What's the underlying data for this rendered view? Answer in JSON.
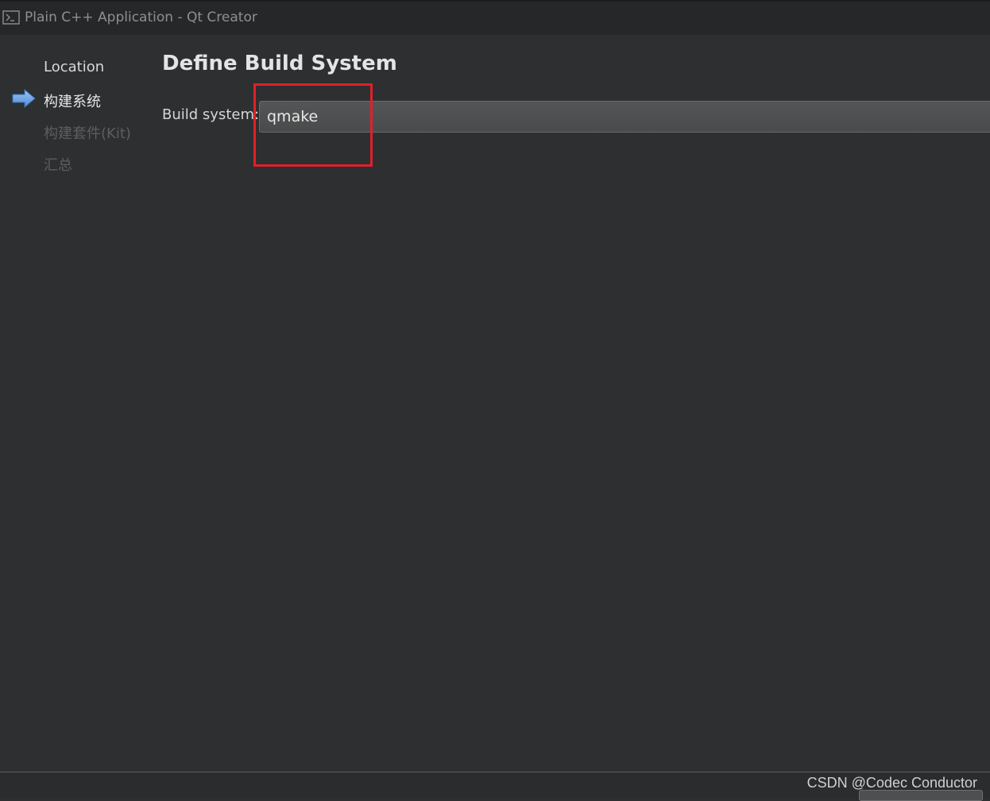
{
  "window": {
    "title": "Plain C++ Application - Qt Creator",
    "icon": "terminal-icon"
  },
  "steps": [
    {
      "label": "Location",
      "state": "done"
    },
    {
      "label": "构建系统",
      "state": "current"
    },
    {
      "label": "构建套件(Kit)",
      "state": "pending"
    },
    {
      "label": "汇总",
      "state": "pending"
    }
  ],
  "page": {
    "title": "Define Build System",
    "build_system_label": "Build system:",
    "build_system_value": "qmake"
  },
  "annotation": {
    "highlight_color": "#e0202a"
  },
  "watermark": "CSDN @Codec Conductor",
  "colors": {
    "background": "#2e2f30",
    "arrow": "#6ea4e6"
  }
}
